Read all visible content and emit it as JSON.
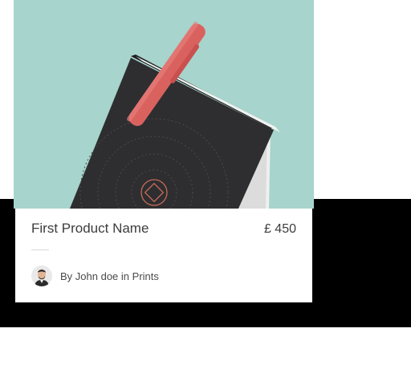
{
  "product": {
    "title": "First Product Name",
    "price": "£ 450",
    "by_prefix": "By",
    "author": "John doe",
    "in_word": "in",
    "category": "Prints",
    "image_background_color": "#a7d4cc",
    "book_color": "#2e2e30",
    "pen_color": "#d9625f"
  }
}
